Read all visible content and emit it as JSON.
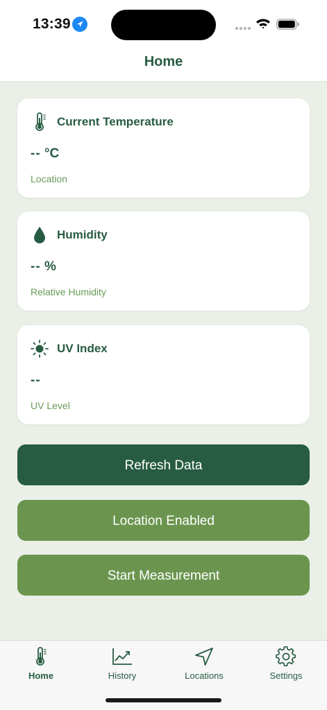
{
  "status_bar": {
    "time": "13:39",
    "location_icon": "location-arrow-icon",
    "signal_icon": "cellular-signal-icon",
    "wifi_icon": "wifi-icon",
    "battery_icon": "battery-icon"
  },
  "header": {
    "title": "Home"
  },
  "cards": [
    {
      "icon": "thermometer-icon",
      "title": "Current Temperature",
      "value": "--",
      "unit": "°C",
      "subtitle": "Location"
    },
    {
      "icon": "water-drop-icon",
      "title": "Humidity",
      "value": "--",
      "unit": "%",
      "subtitle": "Relative Humidity"
    },
    {
      "icon": "sun-icon",
      "title": "UV Index",
      "value": "--",
      "unit": "",
      "subtitle": "UV Level"
    }
  ],
  "buttons": {
    "refresh": "Refresh Data",
    "location": "Location Enabled",
    "measure": "Start Measurement"
  },
  "tabs": [
    {
      "label": "Home",
      "icon": "thermometer-icon",
      "active": true
    },
    {
      "label": "History",
      "icon": "chart-trend-icon",
      "active": false
    },
    {
      "label": "Locations",
      "icon": "navigation-arrow-icon",
      "active": false
    },
    {
      "label": "Settings",
      "icon": "gear-icon",
      "active": false
    }
  ],
  "colors": {
    "primary": "#275c43",
    "secondary": "#6b954f",
    "background": "#eaf0e8",
    "card": "#ffffff"
  }
}
